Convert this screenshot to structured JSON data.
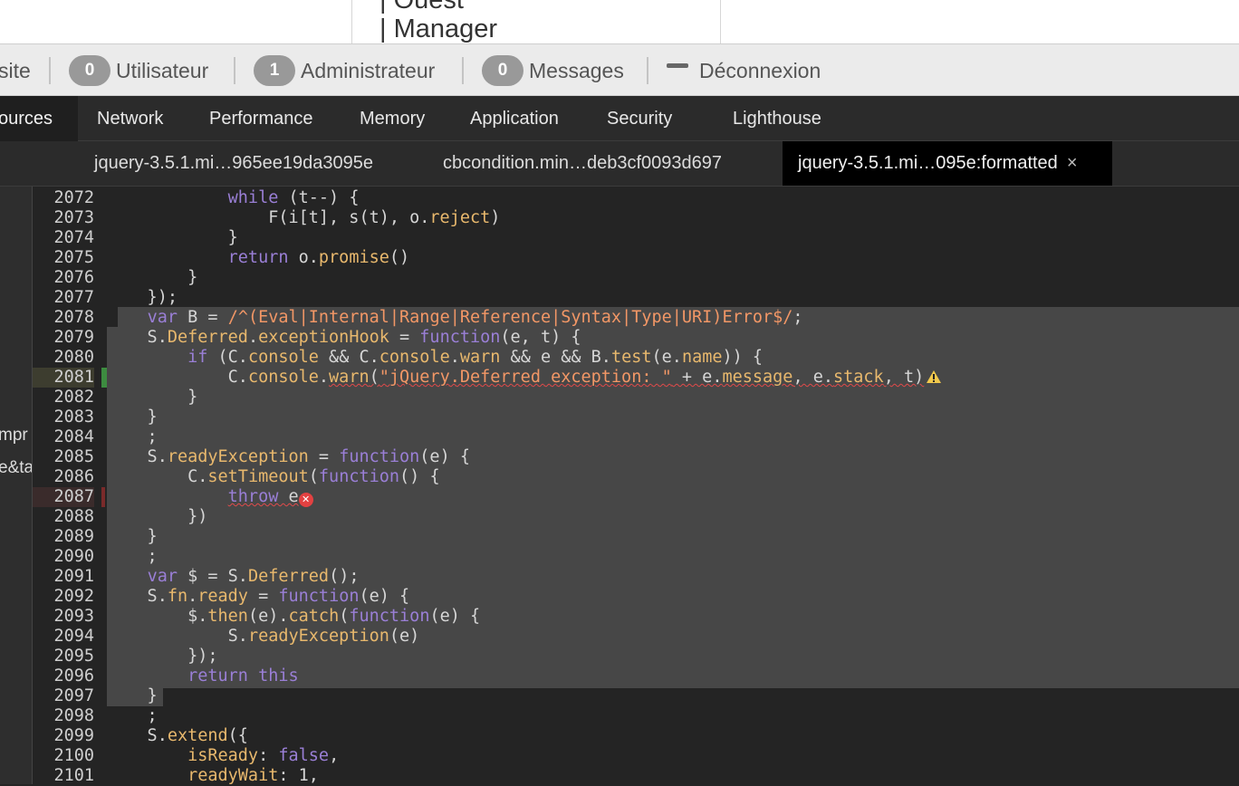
{
  "site_dropdown": {
    "line1": "| Ouest",
    "line2": "| Manager"
  },
  "admin_bar": {
    "site_fragment": "site",
    "users_count": "0",
    "users_label": "Utilisateur",
    "admins_count": "1",
    "admins_label": "Administrateur",
    "messages_count": "0",
    "messages_label": "Messages",
    "logout_label": "Déconnexion"
  },
  "devtools_tabs": [
    "ources",
    "Network",
    "Performance",
    "Memory",
    "Application",
    "Security",
    "Lighthouse"
  ],
  "file_tabs": [
    "jquery-3.5.1.mi…965ee19da3095e",
    "cbcondition.min…deb3cf0093d697",
    "jquery-3.5.1.mi…095e:formatted"
  ],
  "file_close": "×",
  "left_panel": {
    "frag1": "mpr",
    "frag2": "e&ta"
  },
  "code": {
    "line_numbers": [
      "2072",
      "2073",
      "2074",
      "2075",
      "2076",
      "2077",
      "2078",
      "2079",
      "2080",
      "2081",
      "2082",
      "2083",
      "2084",
      "2085",
      "2086",
      "2087",
      "2088",
      "2089",
      "2090",
      "2091",
      "2092",
      "2093",
      "2094",
      "2095",
      "2096",
      "2097",
      "2098",
      "2099",
      "2100",
      "2101"
    ],
    "l2072": {
      "pre": "            ",
      "kw": "while",
      "rest": " (t--) {"
    },
    "l2073": {
      "pre": "                F(i[t], s(t), o.",
      "prop": "reject",
      "rest": ")"
    },
    "l2074": "            }",
    "l2075": {
      "pre": "            ",
      "kw": "return",
      "mid": " o.",
      "prop": "promise",
      "rest": "()"
    },
    "l2076": "        }",
    "l2077": "    });",
    "l2078": {
      "pre": "    ",
      "kw": "var",
      "mid": " B = ",
      "regex": "/^(Eval|Internal|Range|Reference|Syntax|Type|URI)Error$/",
      "rest": ";"
    },
    "l2079": {
      "pre": "    S.",
      "prop1": "Deferred",
      "dot": ".",
      "prop2": "exceptionHook",
      "mid": " = ",
      "kw": "function",
      "args": "(e, t) {"
    },
    "l2080": {
      "pre": "        ",
      "kw": "if",
      "a": " (C.",
      "p1": "console",
      "b": " && C.",
      "p2": "console",
      "c": ".",
      "p3": "warn",
      "d": " && e && B.",
      "p4": "test",
      "e": "(e.",
      "p5": "name",
      "f": ")) {"
    },
    "l2081": {
      "pre": "            C.",
      "p1": "console",
      "dot": ".",
      "p2": "warn",
      "paren": "(",
      "str": "\"jQuery.Deferred exception: \"",
      "a": " + e.",
      "p3": "message",
      "b": ", e.",
      "p4": "stack",
      "c": ", t)"
    },
    "l2082": "        }",
    "l2083": "    }",
    "l2084": "    ;",
    "l2085": {
      "pre": "    S.",
      "prop": "readyException",
      "mid": " = ",
      "kw": "function",
      "rest": "(e) {"
    },
    "l2086": {
      "pre": "        C.",
      "prop": "setTimeout",
      "paren": "(",
      "kw": "function",
      "rest": "() {"
    },
    "l2087": {
      "pre": "            ",
      "kw": "throw",
      "rest": " e"
    },
    "l2088": "        })",
    "l2089": "    }",
    "l2090": "    ;",
    "l2091": {
      "pre": "    ",
      "kw": "var",
      "mid": " $ = S.",
      "prop": "Deferred",
      "rest": "();"
    },
    "l2092": {
      "pre": "    S.",
      "p1": "fn",
      "dot": ".",
      "p2": "ready",
      "mid": " = ",
      "kw": "function",
      "rest": "(e) {"
    },
    "l2093": {
      "pre": "        $.",
      "p1": "then",
      "a": "(e).",
      "p2": "catch",
      "paren": "(",
      "kw": "function",
      "rest": "(e) {"
    },
    "l2094": {
      "pre": "            S.",
      "prop": "readyException",
      "rest": "(e)"
    },
    "l2095": "        });",
    "l2096": {
      "pre": "        ",
      "kw": "return this"
    },
    "l2097": "    }",
    "l2098": "    ;",
    "l2099": {
      "pre": "    S.",
      "prop": "extend",
      "rest": "({"
    },
    "l2100": {
      "pre": "        ",
      "prop": "isReady",
      "a": ": ",
      "kw": "false",
      "rest": ","
    },
    "l2101": {
      "pre": "        ",
      "prop": "readyWait",
      "rest": ": 1,"
    }
  }
}
